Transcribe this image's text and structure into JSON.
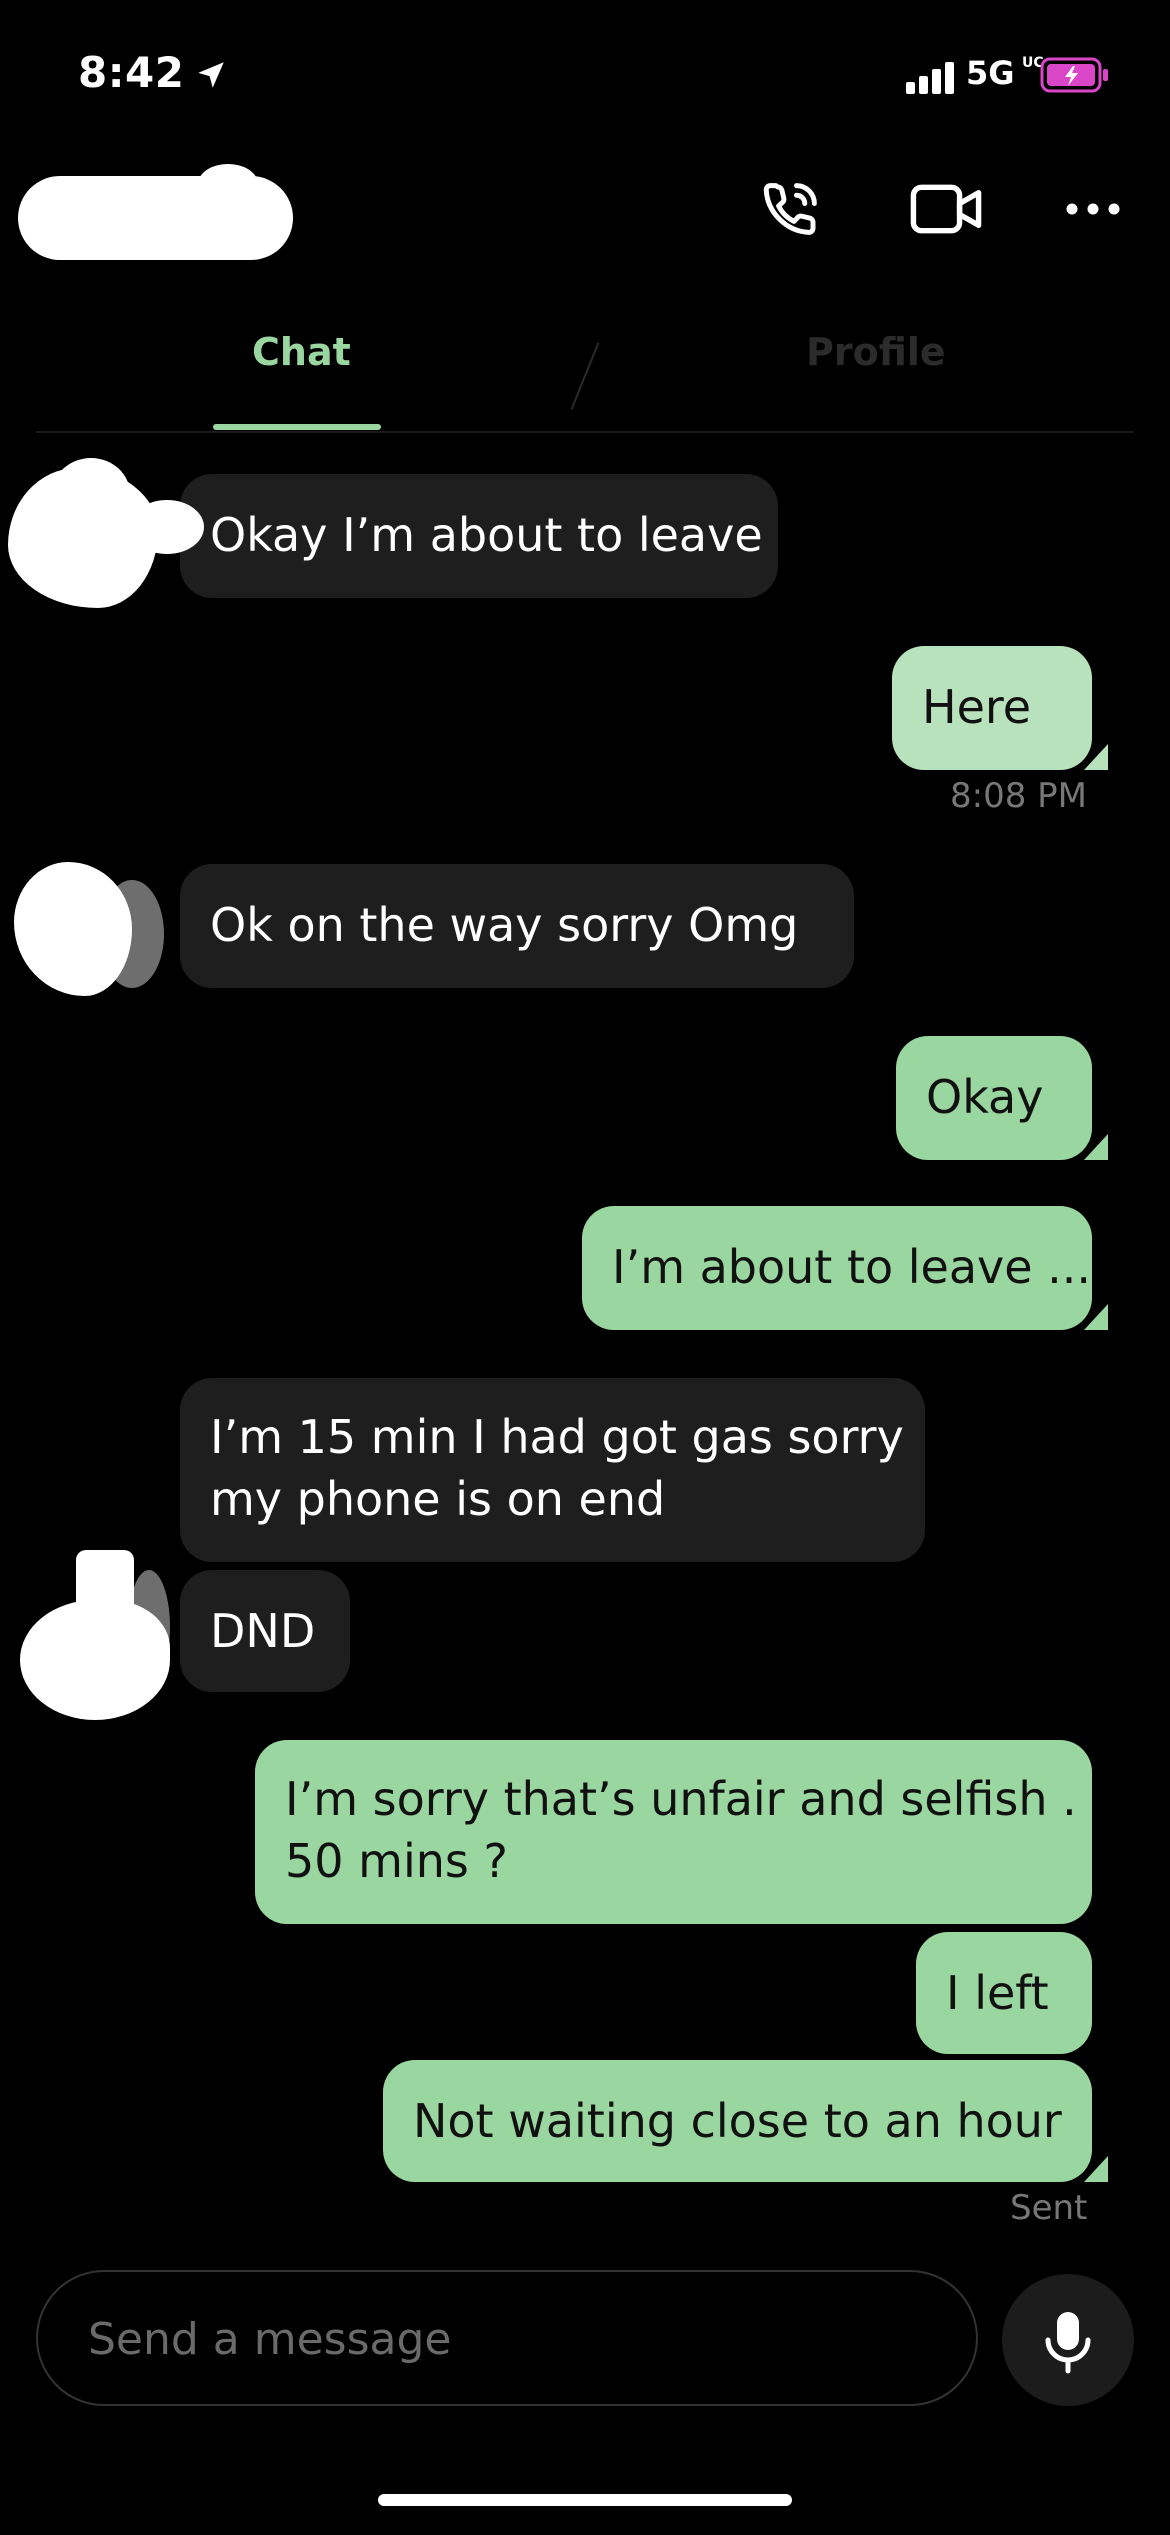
{
  "status_bar": {
    "time": "8:42",
    "network": "5G",
    "network_badge": "UC",
    "battery_state": "charging",
    "colors": {
      "battery": "#d946c8"
    }
  },
  "header": {
    "contact_name_redacted": true,
    "actions": [
      {
        "icon": "phone-icon"
      },
      {
        "icon": "video-camera-icon"
      },
      {
        "icon": "more-horizontal-icon"
      }
    ]
  },
  "tabs": [
    {
      "label": "Chat",
      "active": true
    },
    {
      "label": "Profile",
      "active": false
    }
  ],
  "messages": [
    {
      "direction": "in",
      "text": "Okay I’m about to leave"
    },
    {
      "direction": "out",
      "text": "Here",
      "time": "8:08 PM"
    },
    {
      "direction": "in",
      "text": "Ok on the way sorry Omg"
    },
    {
      "direction": "out",
      "text": "Okay"
    },
    {
      "direction": "out",
      "text": "I’m about to leave ..."
    },
    {
      "direction": "in",
      "lines": [
        "I’m 15 min I had got gas sorry",
        "my phone is on end"
      ]
    },
    {
      "direction": "in",
      "text": "DND"
    },
    {
      "direction": "out",
      "lines": [
        "I’m sorry that’s unfair and selfish .",
        "50 mins ?"
      ]
    },
    {
      "direction": "out",
      "text": "I left"
    },
    {
      "direction": "out",
      "text": "Not waiting close to an hour",
      "status": "Sent"
    }
  ],
  "composer": {
    "placeholder": "Send a message",
    "mic_icon": "microphone-icon"
  },
  "colors": {
    "accent": "#9ad69f",
    "outgoing_bubble": "#9ad69f",
    "incoming_bubble": "#1e1e1e",
    "background": "#000000"
  }
}
